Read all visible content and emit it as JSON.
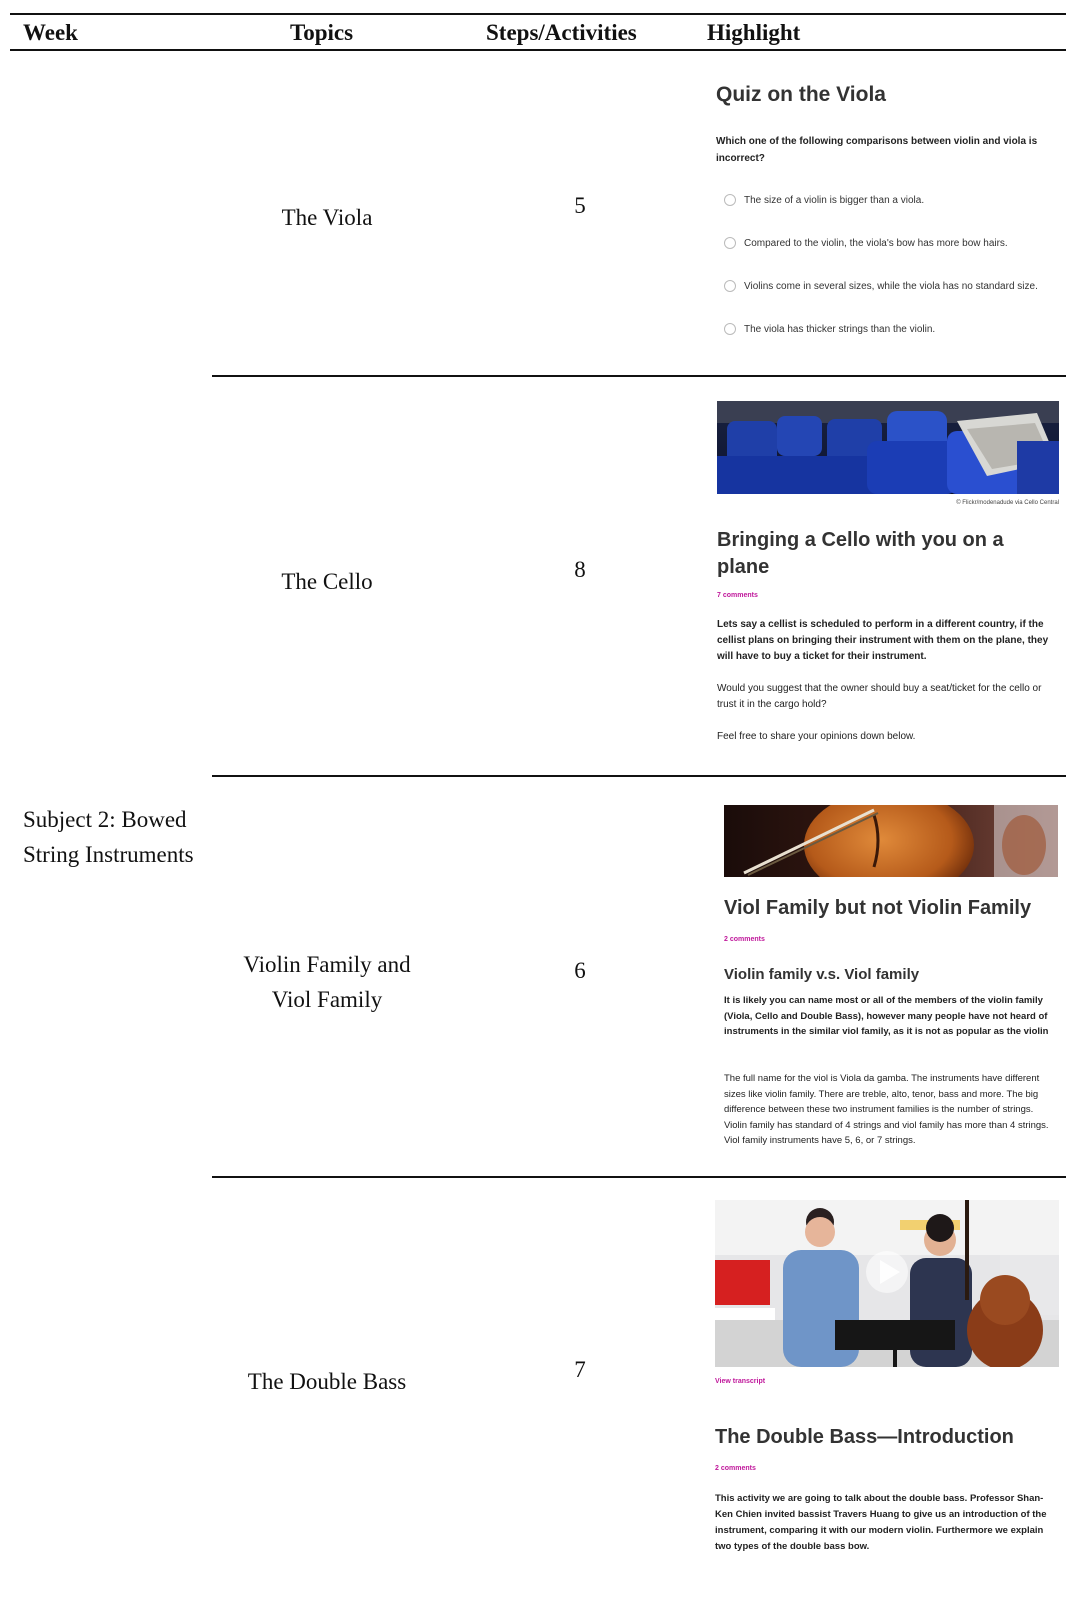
{
  "headers": {
    "week": "Week",
    "topics": "Topics",
    "steps": "Steps/Activities",
    "highlight": "Highlight"
  },
  "week_label": "Subject 2: Bowed String Instruments",
  "rows": [
    {
      "topic": "The Viola",
      "steps": "5",
      "highlight": {
        "title": "Quiz on the Viola",
        "question": "Which one of the following comparisons between violin and viola is incorrect?",
        "options": [
          "The size of a violin is bigger than a viola.",
          "Compared to the violin, the viola's bow has more bow hairs.",
          "Violins come in several sizes, while the viola has no standard size.",
          "The viola has thicker strings than the violin."
        ]
      }
    },
    {
      "topic": "The Cello",
      "steps": "8",
      "highlight": {
        "image_caption": "© Flickr/modenadude via Cello Central",
        "title": "Bringing a Cello with you on a plane",
        "comments": "7 comments",
        "lead": "Lets say a cellist is scheduled to perform in a different country, if the cellist plans on bringing their instrument with them on the plane, they will have to buy a ticket for their instrument.",
        "para1": "Would you suggest that the owner should buy a seat/ticket for the cello or trust it in the cargo hold?",
        "para2": "Feel free to share your opinions down below."
      }
    },
    {
      "topic": "Violin Family and Viol Family",
      "steps": "6",
      "highlight": {
        "title": "Viol Family but not Violin Family",
        "comments": "2 comments",
        "subtitle": "Violin family v.s. Viol family",
        "lead": "It is likely you can name most or all of the members of the violin family (Viola, Cello and Double Bass), however many people have not heard of instruments in the similar viol family, as it is not as popular as the violin",
        "para1": "The full name for the viol is Viola da gamba. The instruments have different sizes like violin family. There are treble, alto, tenor, bass and more. The big difference between these two instrument families is the number of strings. Violin family has standard of 4 strings and viol family has more than 4 strings. Viol family instruments have 5, 6, or 7 strings."
      }
    },
    {
      "topic": "The Double Bass",
      "steps": "7",
      "highlight": {
        "transcript_link": "View transcript",
        "title": "The Double Bass—Introduction",
        "comments": "2 comments",
        "lead": "This activity we are going to talk about the double bass. Professor Shan-Ken Chien invited bassist Travers Huang to give us an introduction of the instrument, comparing it with our modern violin. Furthermore we explain two types of the double bass bow."
      }
    }
  ],
  "colors": {
    "accent": "#c0189b",
    "rule": "#111111"
  }
}
